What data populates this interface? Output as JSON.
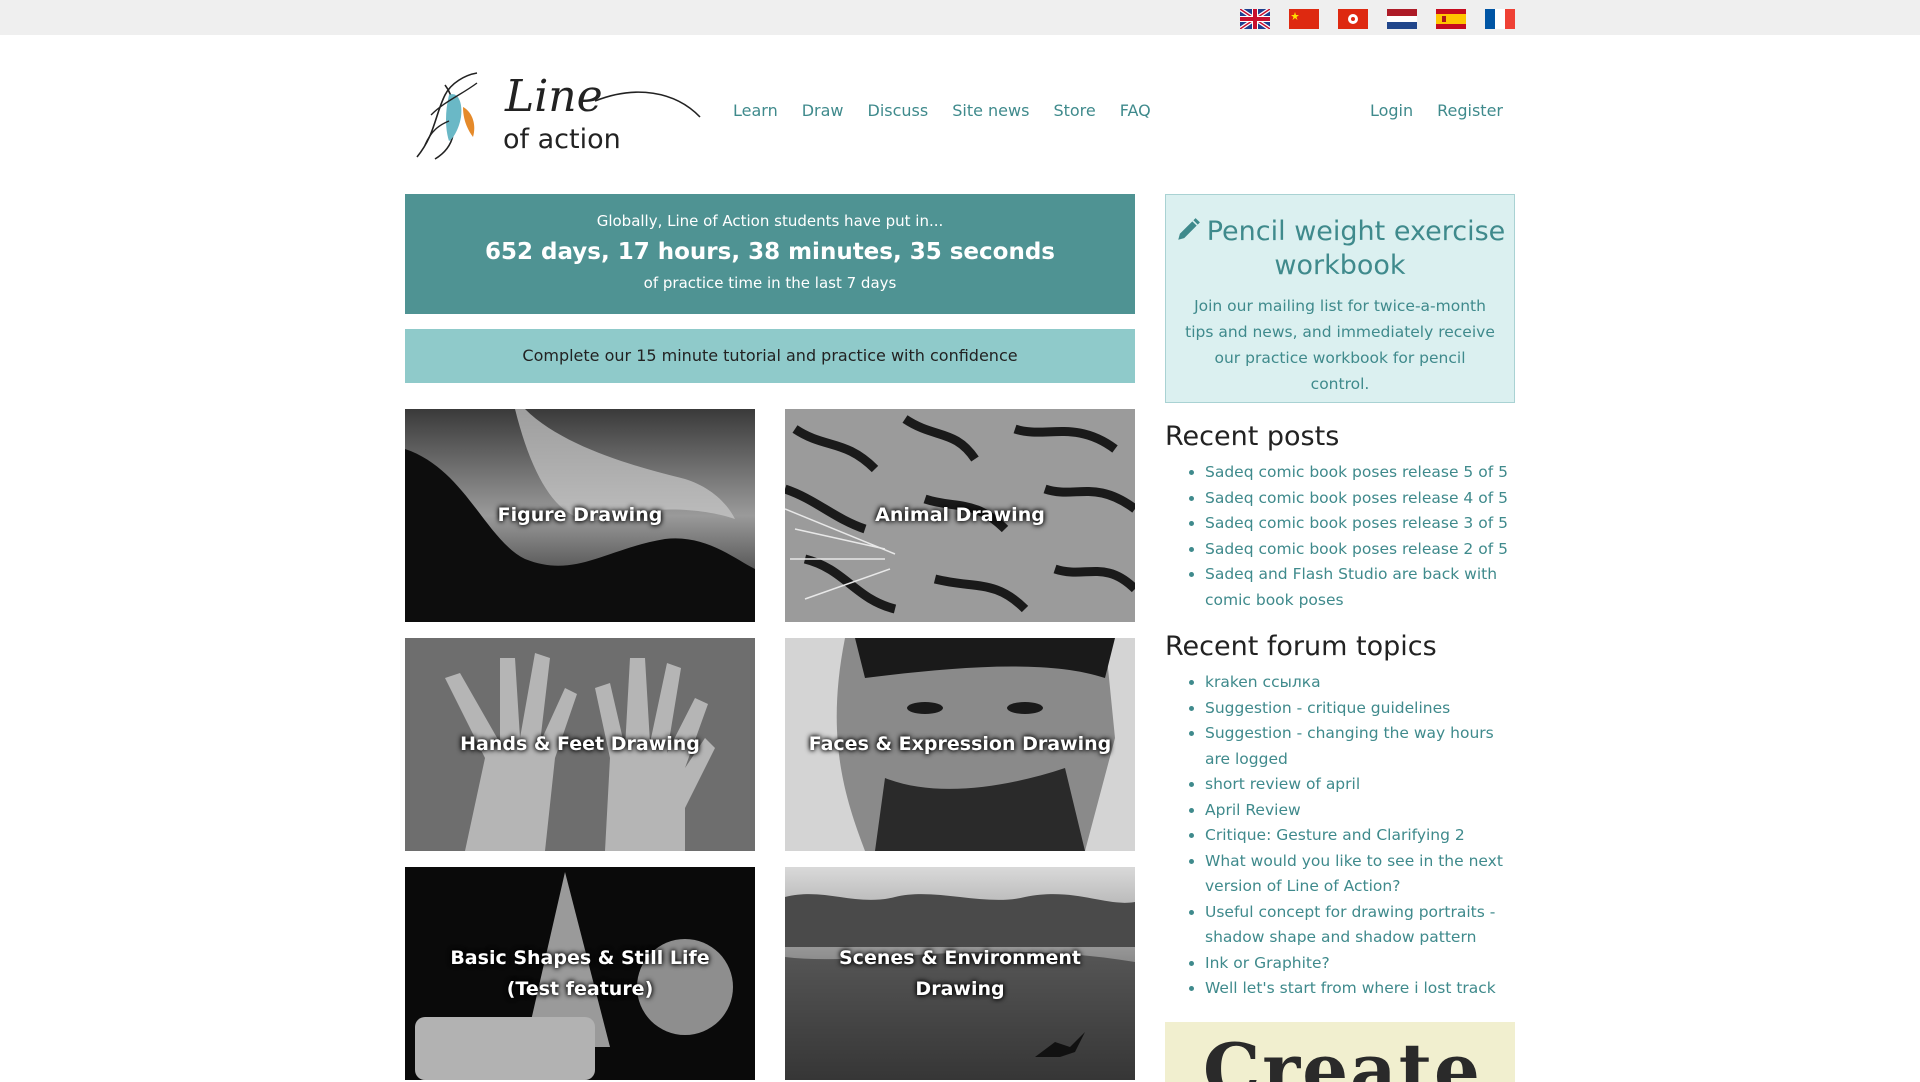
{
  "flags": [
    {
      "icon": "uk-flag-icon"
    },
    {
      "icon": "china-flag-icon"
    },
    {
      "icon": "hong-kong-flag-icon"
    },
    {
      "icon": "netherlands-flag-icon"
    },
    {
      "icon": "spain-flag-icon"
    },
    {
      "icon": "france-flag-icon"
    }
  ],
  "logo": {
    "line1": "Line",
    "line2": "of action"
  },
  "nav": {
    "items": [
      "Learn",
      "Draw",
      "Discuss",
      "Site news",
      "Store",
      "FAQ"
    ],
    "login": "Login",
    "register": "Register"
  },
  "stats": {
    "intro": "Globally, Line of Action students have put in...",
    "total": "652 days, 17 hours, 38 minutes, 35 seconds",
    "suffix": "of practice time in the last 7 days"
  },
  "tutorial": "Complete our 15 minute tutorial and practice with confidence",
  "tiles": [
    {
      "label": "Figure Drawing"
    },
    {
      "label": "Animal Drawing"
    },
    {
      "label": "Hands & Feet Drawing"
    },
    {
      "label": "Faces & Expression Drawing"
    },
    {
      "label": "Basic Shapes & Still Life (Test feature)"
    },
    {
      "label": "Scenes & Environment Drawing"
    }
  ],
  "promo": {
    "title": "Pencil weight exercise workbook",
    "desc": "Join our mailing list for twice-a-month tips and news, and immediately receive our practice workbook for pencil control."
  },
  "recent_posts": {
    "heading": "Recent posts",
    "items": [
      "Sadeq comic book poses release 5 of 5",
      "Sadeq comic book poses release 4 of 5",
      "Sadeq comic book poses release 3 of 5",
      "Sadeq comic book poses release 2 of 5",
      "Sadeq and Flash Studio are back with comic book poses"
    ]
  },
  "forum_topics": {
    "heading": "Recent forum topics",
    "items": [
      "kraken ссылка",
      "Suggestion - critique guidelines",
      "Suggestion - changing the way hours are logged",
      "short review of april",
      "April Review",
      "Critique: Gesture and Clarifying 2",
      "What would you like to see in the next version of Line of Action?",
      "Useful concept for drawing portraits - shadow shape and shadow pattern",
      "Ink or Graphite?",
      "Well let's start from where i lost track"
    ]
  },
  "banner": {
    "text": "Create"
  },
  "colors": {
    "accent": "#3f8a8c",
    "stats_bg": "#4f9393",
    "tutorial_bg": "#8fcaca",
    "promo_bg": "#dbf0f0"
  }
}
